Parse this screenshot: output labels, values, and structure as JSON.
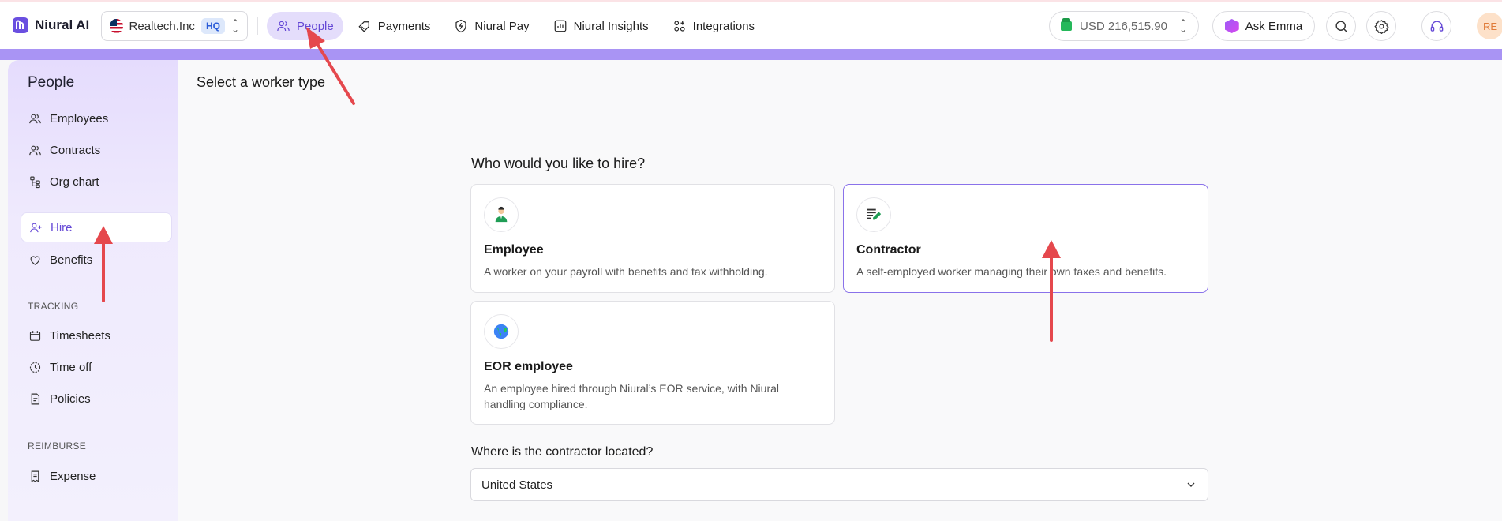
{
  "topbar": {
    "brand": "Niural AI",
    "org_name": "Realtech.Inc",
    "org_badge": "HQ",
    "nav": [
      {
        "label": "People",
        "icon": "people-icon",
        "active": true
      },
      {
        "label": "Payments",
        "icon": "tag-icon",
        "active": false
      },
      {
        "label": "Niural Pay",
        "icon": "shield-bolt-icon",
        "active": false
      },
      {
        "label": "Niural Insights",
        "icon": "bar-chart-icon",
        "active": false
      },
      {
        "label": "Integrations",
        "icon": "integrations-icon",
        "active": false
      }
    ],
    "balance": "USD 216,515.90",
    "ask_label": "Ask Emma",
    "avatar_initials": "RE"
  },
  "sidebar": {
    "title": "People",
    "items": [
      {
        "label": "Employees",
        "icon": "users-icon"
      },
      {
        "label": "Contracts",
        "icon": "users-icon"
      },
      {
        "label": "Org chart",
        "icon": "org-chart-icon"
      },
      {
        "label": "Hire",
        "icon": "user-plus-icon",
        "active": true
      },
      {
        "label": "Benefits",
        "icon": "heart-icon"
      }
    ],
    "tracking_label": "TRACKING",
    "tracking_items": [
      {
        "label": "Timesheets",
        "icon": "calendar-icon"
      },
      {
        "label": "Time off",
        "icon": "clock-icon"
      },
      {
        "label": "Policies",
        "icon": "document-icon"
      }
    ],
    "reimburse_label": "REIMBURSE",
    "reimburse_items": [
      {
        "label": "Expense",
        "icon": "receipt-icon"
      }
    ]
  },
  "main": {
    "page_title": "Select a worker type",
    "question": "Who would you like to hire?",
    "cards": [
      {
        "title": "Employee",
        "desc": "A worker on your payroll with benefits and tax withholding.",
        "icon": "employee-icon",
        "selected": false
      },
      {
        "title": "Contractor",
        "desc": "A self-employed worker managing their own taxes and benefits.",
        "icon": "contract-icon",
        "selected": true
      },
      {
        "title": "EOR employee",
        "desc": "An employee hired through Niural’s EOR service, with Niural handling compliance.",
        "icon": "globe-icon",
        "selected": false
      }
    ],
    "location_question": "Where is the contractor located?",
    "location_value": "United States"
  },
  "colors": {
    "accent": "#6548d6",
    "annotation_arrow": "#e5484d"
  }
}
